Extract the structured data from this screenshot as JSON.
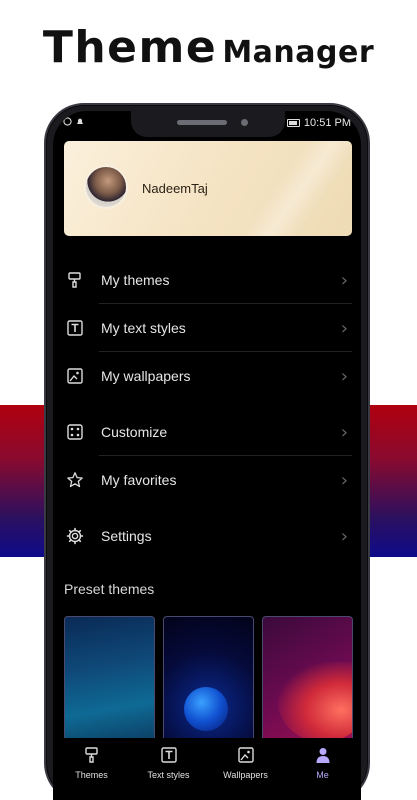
{
  "headline": {
    "big": "Theme",
    "small": "Manager"
  },
  "status_bar": {
    "time": "10:51 PM"
  },
  "profile": {
    "name": "NadeemTaj"
  },
  "menu": [
    {
      "label": "My themes",
      "icon": "paint-roller-icon"
    },
    {
      "label": "My text styles",
      "icon": "text-icon"
    },
    {
      "label": "My wallpapers",
      "icon": "image-icon"
    },
    {
      "label": "Customize",
      "icon": "dice-icon"
    },
    {
      "label": "My favorites",
      "icon": "star-icon"
    },
    {
      "label": "Settings",
      "icon": "gear-icon"
    }
  ],
  "preset": {
    "title": "Preset themes"
  },
  "bottom_nav": [
    {
      "label": "Themes",
      "icon": "paint-roller-icon"
    },
    {
      "label": "Text styles",
      "icon": "text-icon"
    },
    {
      "label": "Wallpapers",
      "icon": "image-icon"
    },
    {
      "label": "Me",
      "icon": "person-icon",
      "active": true
    }
  ],
  "colors": {
    "accent": "#b9a8ff",
    "stripe_top": "#b0000f",
    "stripe_bottom": "#0e0b8a"
  }
}
